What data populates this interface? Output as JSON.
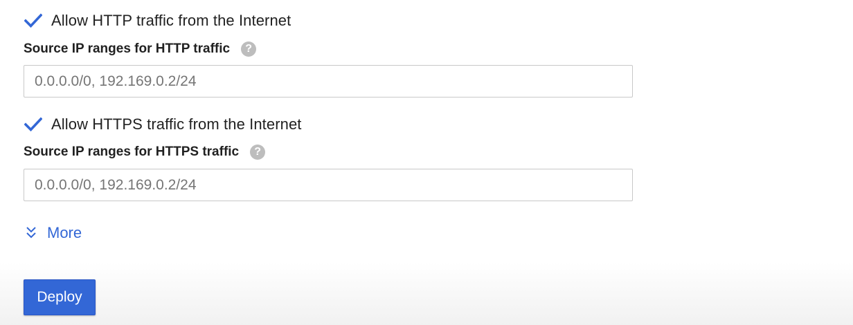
{
  "http": {
    "checkbox_label": "Allow HTTP traffic from the Internet",
    "checked": true,
    "field_label": "Source IP ranges for HTTP traffic",
    "input_value": "0.0.0.0/0, 192.169.0.2/24"
  },
  "https": {
    "checkbox_label": "Allow HTTPS traffic from the Internet",
    "checked": true,
    "field_label": "Source IP ranges for HTTPS traffic",
    "input_value": "0.0.0.0/0, 192.169.0.2/24"
  },
  "more": {
    "label": "More",
    "icon": "chevron-double-down-icon"
  },
  "deploy": {
    "label": "Deploy"
  },
  "help_icon_glyph": "?",
  "colors": {
    "accent": "#3367d6",
    "checkbox_check": "#3367d6",
    "help_icon": "#bdbdbd",
    "input_border": "#c8c8c8"
  }
}
